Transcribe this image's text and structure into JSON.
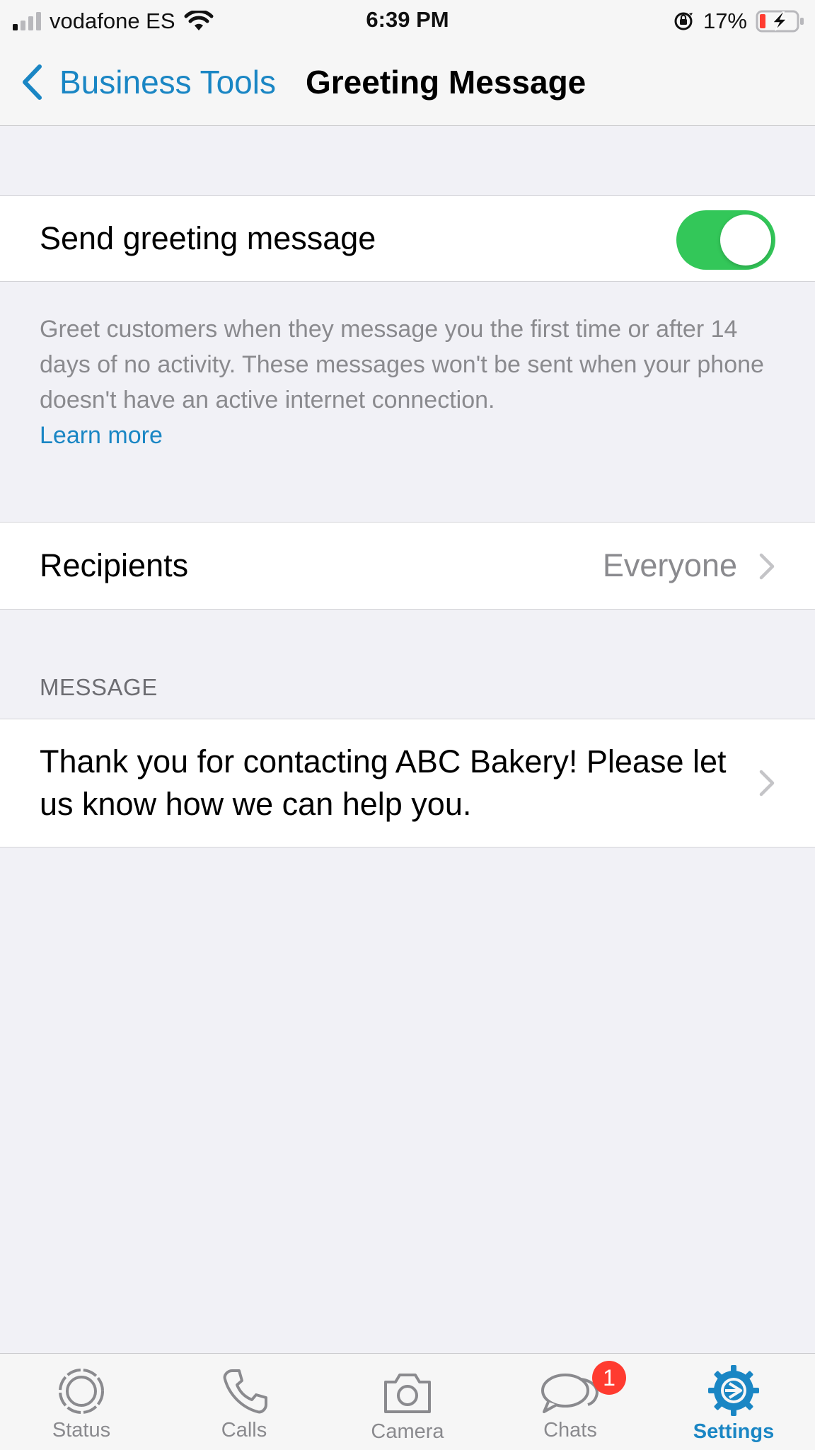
{
  "status_bar": {
    "carrier": "vodafone ES",
    "time": "6:39 PM",
    "battery_percent": "17%",
    "signal_bars_filled": 1,
    "signal_bars_total": 4
  },
  "nav": {
    "back_label": "Business Tools",
    "title": "Greeting Message"
  },
  "greeting_toggle": {
    "label": "Send greeting message",
    "enabled": true
  },
  "info": {
    "description": "Greet customers when they message you the first time or after 14 days of no activity. These messages won't be sent when your phone doesn't have an active internet connection.",
    "learn_more": "Learn more"
  },
  "recipients": {
    "label": "Recipients",
    "value": "Everyone"
  },
  "message_section": {
    "header": "MESSAGE",
    "text": "Thank you for contacting ABC Bakery! Please let us know how we can help you."
  },
  "tab_bar": {
    "tabs": [
      {
        "label": "Status",
        "icon": "status-icon"
      },
      {
        "label": "Calls",
        "icon": "phone-icon"
      },
      {
        "label": "Camera",
        "icon": "camera-icon"
      },
      {
        "label": "Chats",
        "icon": "chats-icon",
        "badge": "1"
      },
      {
        "label": "Settings",
        "icon": "gear-icon",
        "active": true
      }
    ]
  },
  "colors": {
    "accent": "#1a86c4",
    "toggle_on": "#33c759",
    "badge": "#ff3b30",
    "background": "#f1f1f6"
  }
}
